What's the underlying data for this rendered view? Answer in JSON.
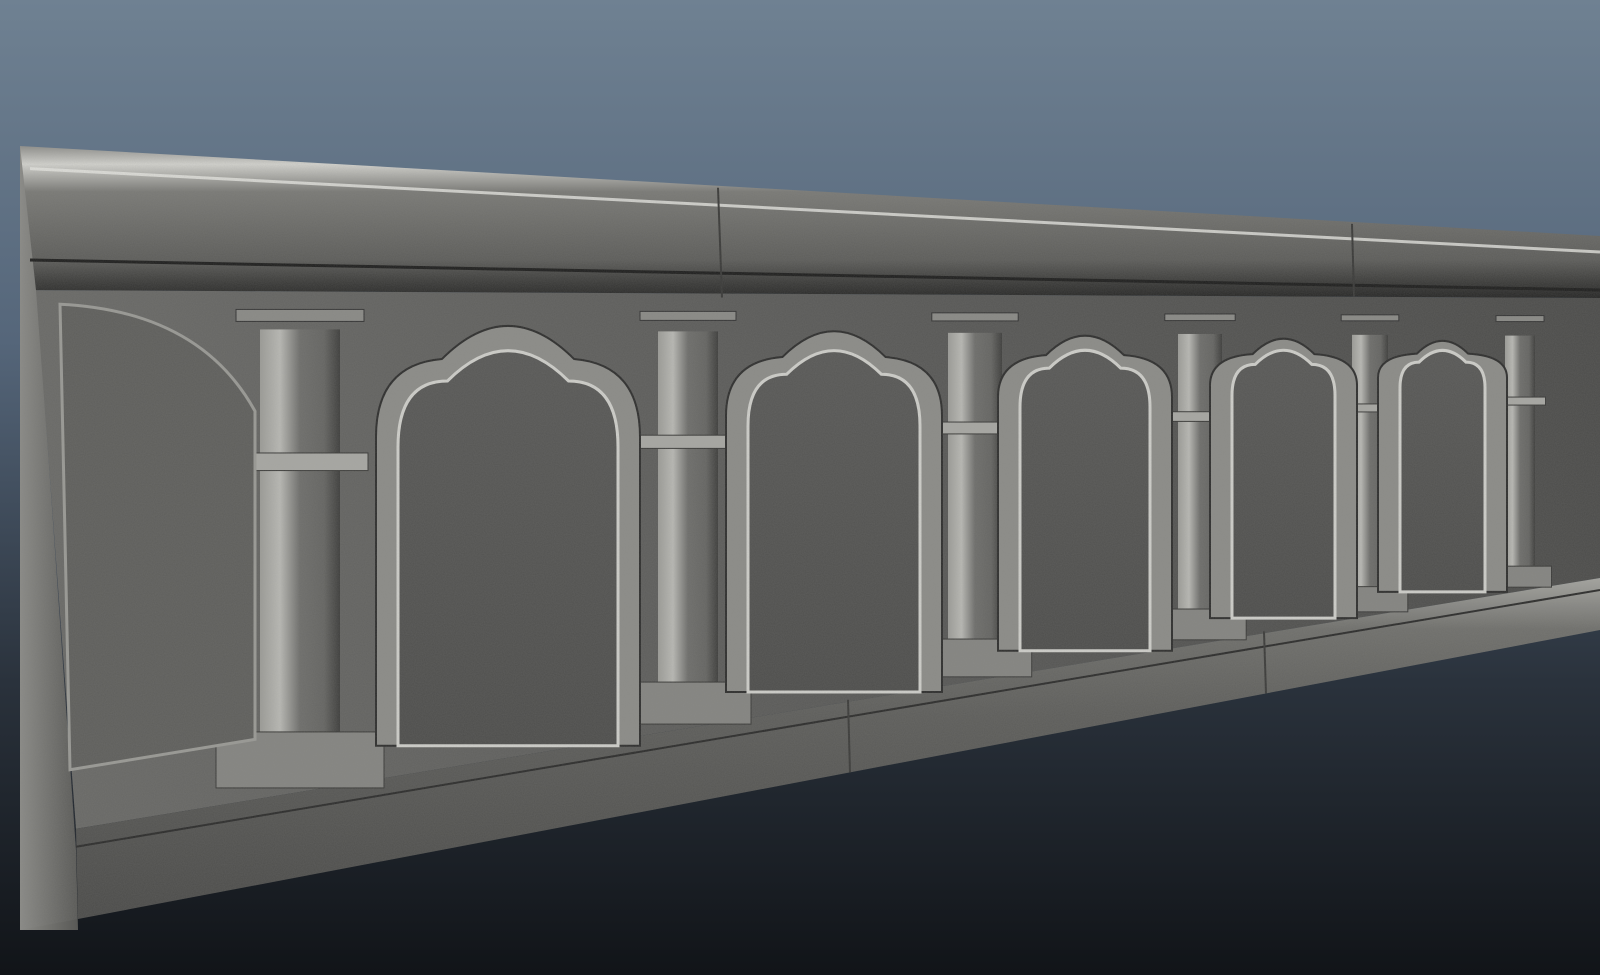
{
  "viewport": {
    "background_top": "#6f8192",
    "background_bottom": "#111418"
  },
  "model": {
    "subject": "concrete-gothic-arcade-wall-panel",
    "base_color": "#5e5e5c",
    "highlight_color": "#c9c9c5",
    "shadow_color": "#2a2a29",
    "arch_count": 6
  }
}
